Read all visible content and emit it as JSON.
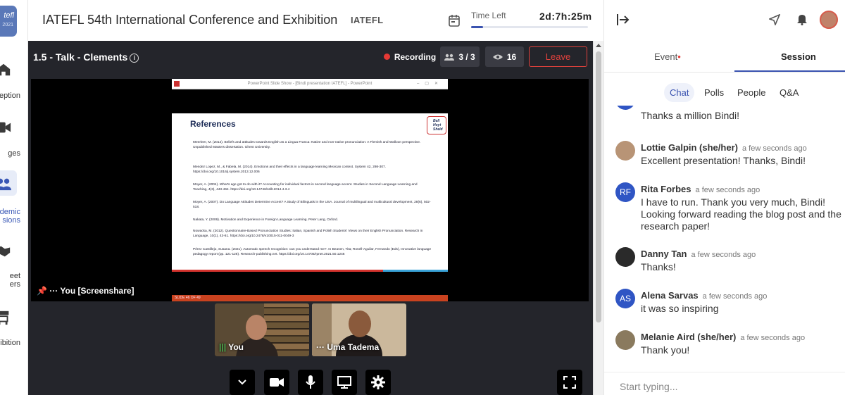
{
  "nav": {
    "items": [
      {
        "label": "eption",
        "icon": "home-icon"
      },
      {
        "label": "ges",
        "icon": "video-icon"
      },
      {
        "label": "demic\nsions",
        "icon": "people-icon"
      },
      {
        "label": "eet\ners",
        "icon": "handshake-icon"
      },
      {
        "label": "ibition",
        "icon": "booth-icon"
      }
    ],
    "logo_text": "tefl",
    "logo_year": "2021"
  },
  "header": {
    "title": "IATEFL 54th International Conference and Exhibition",
    "organizer": "IATEFL",
    "time_left_label": "Time Left",
    "time_left_value": "2d:7h:25m",
    "time_progress": 0.1
  },
  "stage": {
    "session_title": "1.5 - Talk - Clements",
    "recording_label": "Recording",
    "participants": "3 / 3",
    "viewers": "16",
    "leave_label": "Leave",
    "screenshare_label": "··· You [Screenshare]",
    "slide": {
      "window_title": "PowerPoint Slide Show - [Bindi presentation IATEFL] - PowerPoint",
      "heading": "References",
      "badge": "Bell Hoyt Sheld",
      "footer": "SLIDE 46 OF 49",
      "references": [
        "Meerleer, M. (2012). Beliefs and attitudes towards English as a Lingua Franca: Native and non-native pronunciation: A Flemish and Walloon perspective. Unpublished Masters dissertation. Ghent University.",
        "Mendez Lopez, M., & Fabela, M. (2014). Emotions and their effects in a language learning Mexican context. System 42, 298-307. https://doi.org/10.1016/j.system.2013.12.006",
        "Moyer, A. (2004). What's age got to do with it? Accounting for individual factors in second language accent. Studies in Second Language Learning and Teaching, 4(3), 443-464. https://doi.org/10.14746/ssllt.2014.4.3.4",
        "Moyer, A. (2007). Do Language Attitudes Determine Accent? A Study of Bilinguals in the USA. Journal of multilingual and multicultural development, 28(6), 502-518.",
        "Nakata, Y. (2006). Motivation and Experience in Foreign Language Learning. Peter Lang, Oxford.",
        "Nowacka, M. (2012). Questionnaire-Based Pronunciation Studies: Italian, Spanish and Polish Students' Views on their English Pronunciation. Research in Language, 10(1), 43-61. https://doi.org/10.2478/v10015-011-0049-3",
        "Pérez Castillejo, Susana. (2021). Automatic speech recognition: can you understand me?. In Beaven, Tita; Rosell-Aguilar, Fernando (Eds), Innovative language pedagogy report (pp. 121-126). Research-publishing.net. https://doi.org/10.14705/rpnet.2021.50.1246"
      ]
    },
    "tiles": [
      {
        "name": "You",
        "prefix": "|||"
      },
      {
        "name": "Uma Tadema",
        "prefix": "···"
      }
    ],
    "controls": [
      "chevron-down-icon",
      "camera-icon",
      "microphone-icon",
      "monitor-icon",
      "gear-icon"
    ]
  },
  "panel": {
    "tabs": [
      {
        "label": "Event",
        "dot": "•"
      },
      {
        "label": "Session"
      }
    ],
    "subtabs": [
      "Chat",
      "Polls",
      "People",
      "Q&A"
    ],
    "messages": [
      {
        "sender": "",
        "initials": "",
        "ago": "",
        "text": "Thanks a million Bindi!"
      },
      {
        "sender": "Lottie Galpin (she/her)",
        "initials": "",
        "ago": "a few seconds ago",
        "text": "Excellent presentation! Thanks, Bindi!"
      },
      {
        "sender": "Rita Forbes",
        "initials": "RF",
        "ago": "a few seconds ago",
        "text": "I have to run. Thank you very much, Bindi! Looking forward reading the blog post and the research paper!"
      },
      {
        "sender": "Danny Tan",
        "initials": "",
        "ago": "a few seconds ago",
        "text": "Thanks!"
      },
      {
        "sender": "Alena Sarvas",
        "initials": "AS",
        "ago": "a few seconds ago",
        "text": "it was so inspiring"
      },
      {
        "sender": "Melanie Aird (she/her)",
        "initials": "",
        "ago": "a few seconds ago",
        "text": "Thank you!"
      }
    ],
    "input_placeholder": "Start typing..."
  },
  "colors": {
    "accent": "#3a53b0",
    "record": "#e53935",
    "stage": "#24252b"
  }
}
